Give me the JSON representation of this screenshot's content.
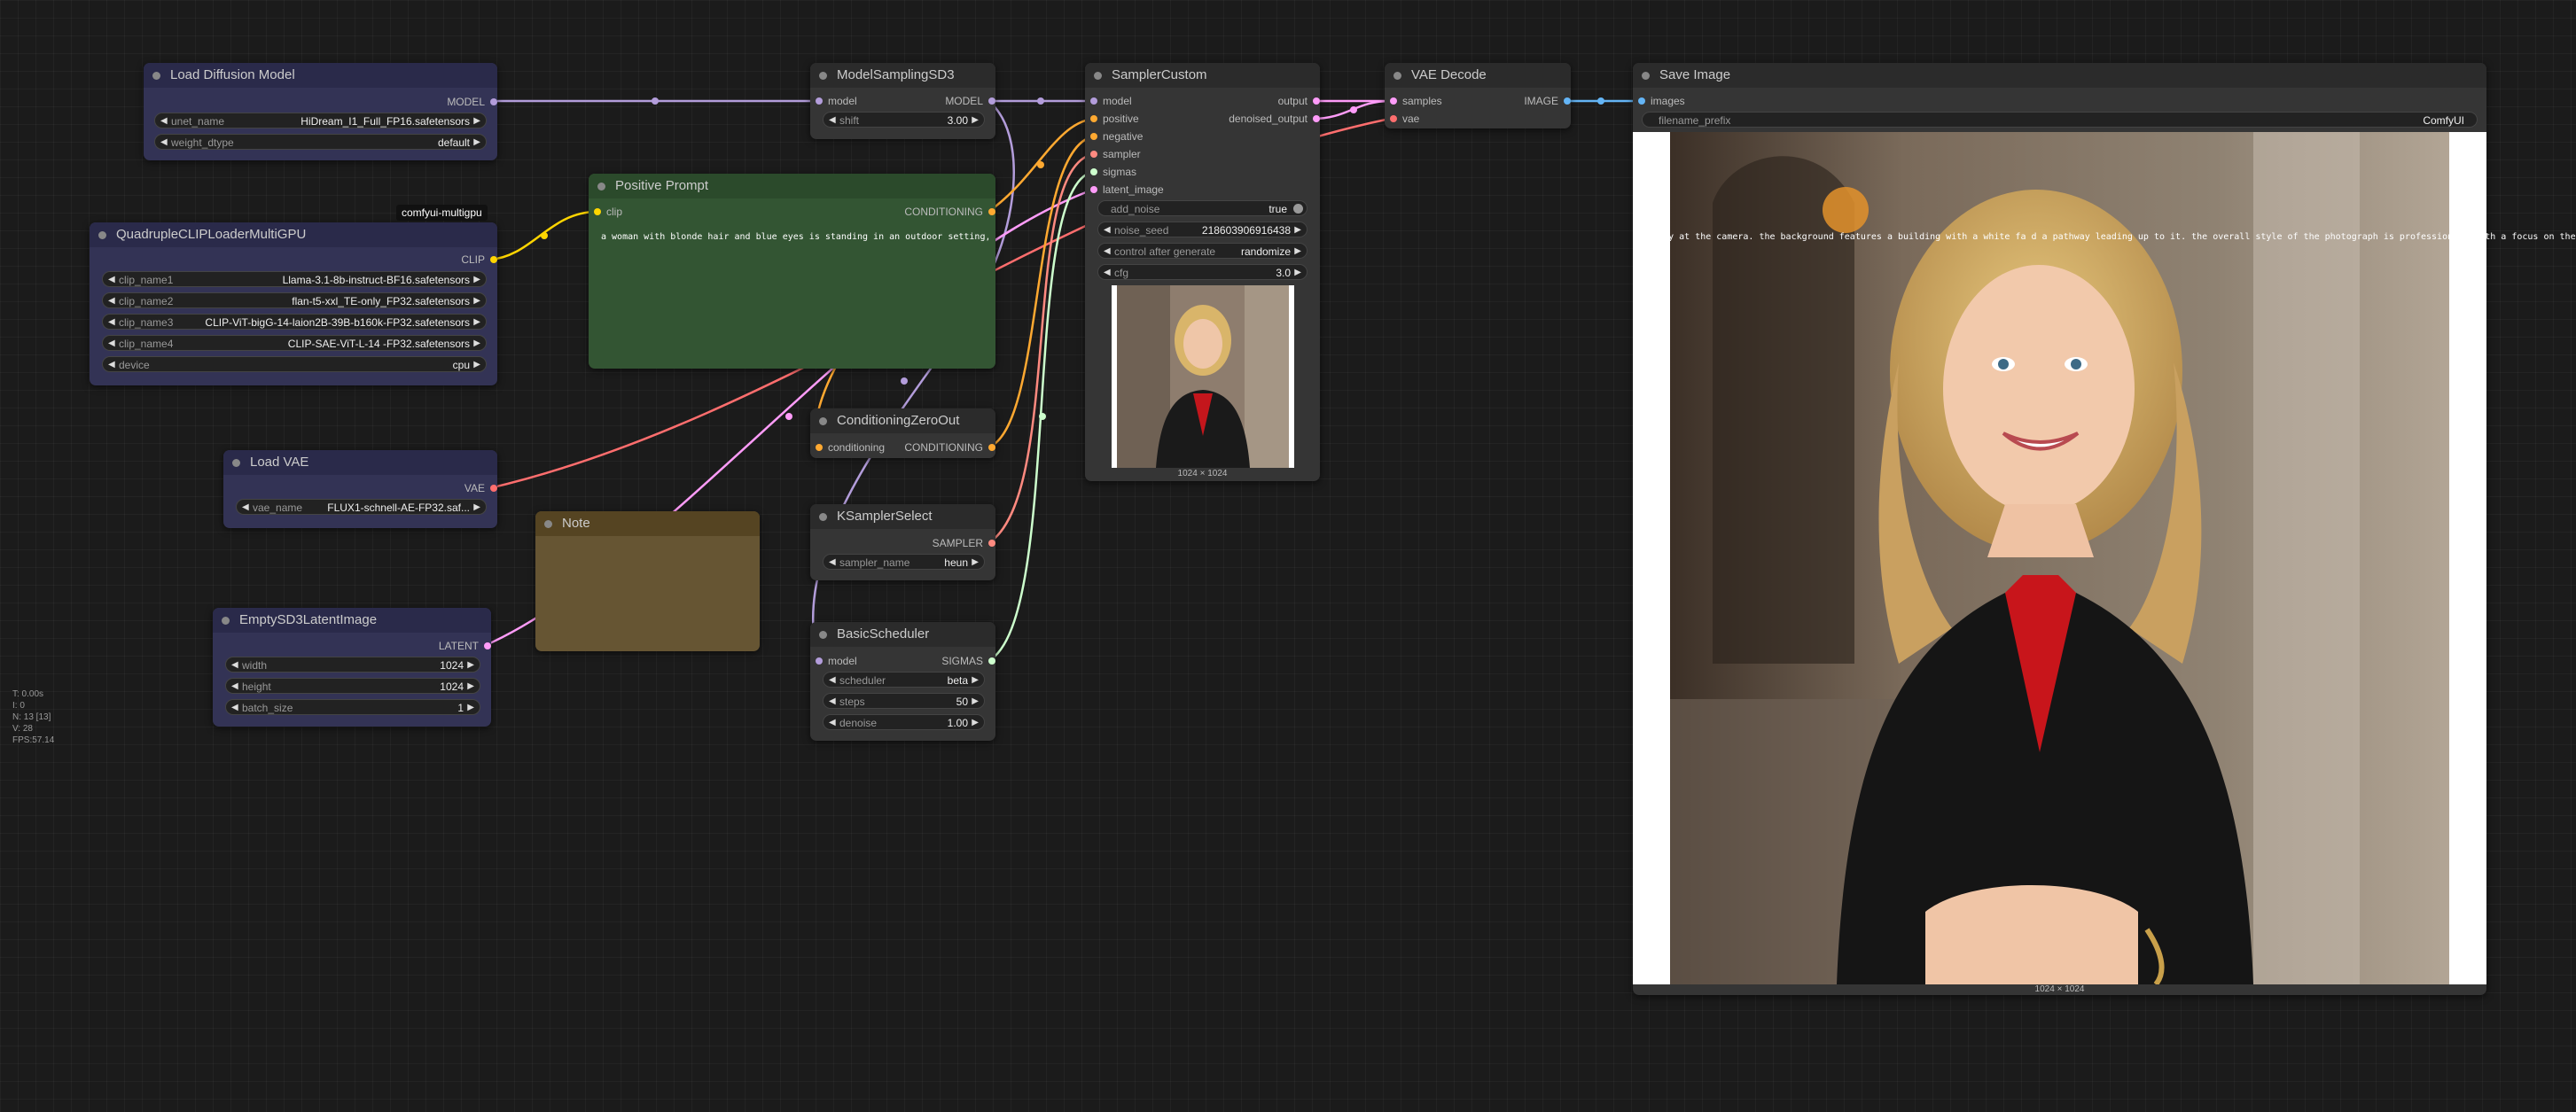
{
  "colors": {
    "model": "#b39ddb",
    "clip": "#ffd500",
    "vae": "#ff6e6e",
    "latent": "#ff9cf9",
    "conditioning": "#ffa931",
    "image": "#64b5f6",
    "sampler": "#ff8a80",
    "sigmas": "#cdffcd"
  },
  "nodes": {
    "load_diffusion": {
      "title": "Load Diffusion Model",
      "out": "MODEL",
      "w1_label": "unet_name",
      "w1_value": "HiDream_I1_Full_FP16.safetensors",
      "w2_label": "weight_dtype",
      "w2_value": "default"
    },
    "clip_loader": {
      "title": "QuadrupleCLIPLoaderMultiGPU",
      "out": "CLIP",
      "badge": "comfyui-multigpu",
      "widgets": [
        {
          "label": "clip_name1",
          "value": "Llama-3.1-8b-instruct-BF16.safetensors"
        },
        {
          "label": "clip_name2",
          "value": "flan-t5-xxl_TE-only_FP32.safetensors"
        },
        {
          "label": "clip_name3",
          "value": "CLIP-ViT-bigG-14-laion2B-39B-b160k-FP32.safetensors"
        },
        {
          "label": "clip_name4",
          "value": "CLIP-SAE-ViT-L-14 -FP32.safetensors"
        },
        {
          "label": "device",
          "value": "cpu"
        }
      ]
    },
    "load_vae": {
      "title": "Load VAE",
      "out": "VAE",
      "w1_label": "vae_name",
      "w1_value": "FLUX1-schnell-AE-FP32.saf..."
    },
    "empty_latent": {
      "title": "EmptySD3LatentImage",
      "out": "LATENT",
      "widgets": [
        {
          "label": "width",
          "value": "1024"
        },
        {
          "label": "height",
          "value": "1024"
        },
        {
          "label": "batch_size",
          "value": "1"
        }
      ]
    },
    "msd3": {
      "title": "ModelSamplingSD3",
      "in": "model",
      "out": "MODEL",
      "w1_label": "shift",
      "w1_value": "3.00"
    },
    "positive": {
      "title": "Positive Prompt",
      "in": "clip",
      "out": "CONDITIONING",
      "text": "a woman with blonde hair and blue eyes is standing in an outdoor setting, wearing a black blazer over a red to"
    },
    "zero_out": {
      "title": "ConditioningZeroOut",
      "in": "conditioning",
      "out": "CONDITIONING"
    },
    "note": {
      "title": "Note"
    },
    "ksampler_select": {
      "title": "KSamplerSelect",
      "out": "SAMPLER",
      "w1_label": "sampler_name",
      "w1_value": "heun"
    },
    "scheduler": {
      "title": "BasicScheduler",
      "in": "model",
      "out": "SIGMAS",
      "widgets": [
        {
          "label": "scheduler",
          "value": "beta"
        },
        {
          "label": "steps",
          "value": "50"
        },
        {
          "label": "denoise",
          "value": "1.00"
        }
      ]
    },
    "sampler_custom": {
      "title": "SamplerCustom",
      "inputs": [
        "model",
        "positive",
        "negative",
        "sampler",
        "sigmas",
        "latent_image"
      ],
      "outputs": [
        "output",
        "denoised_output"
      ],
      "toggle_label": "add_noise",
      "toggle_value": "true",
      "widgets": [
        {
          "label": "noise_seed",
          "value": "218603906916438"
        },
        {
          "label": "control after generate",
          "value": "randomize"
        },
        {
          "label": "cfg",
          "value": "3.0"
        }
      ],
      "caption": "1024 × 1024"
    },
    "vae_decode": {
      "title": "VAE Decode",
      "inputs": [
        "samples",
        "vae"
      ],
      "out": "IMAGE"
    },
    "save_image": {
      "title": "Save Image",
      "in": "images",
      "w1_label": "filename_prefix",
      "w1_value": "ComfyUI",
      "caption": "1024 × 1024",
      "overlay_text": "rectly at the camera. the background features a building with a white fa      d a pathway leading up to it. the overall style of the photograph is professional, with a focus on the subject's features."
    }
  },
  "stats": [
    "T: 0.00s",
    "I: 0",
    "N: 13 [13]",
    "V: 28",
    "FPS:57.14"
  ]
}
